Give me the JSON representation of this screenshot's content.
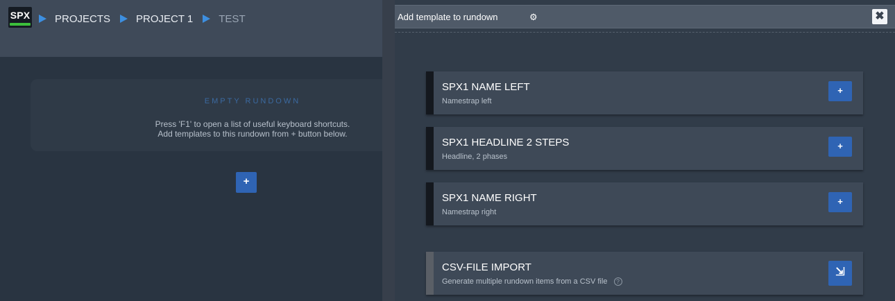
{
  "logo": {
    "text": "SPX",
    "accent": "#3cbf3c"
  },
  "breadcrumb": [
    {
      "label": "PROJECTS"
    },
    {
      "label": "PROJECT 1"
    },
    {
      "label": "TEST"
    }
  ],
  "rundown": {
    "empty_title": "EMPTY RUNDOWN",
    "help_line1": "Press 'F1' to open a list of useful keyboard shortcuts.",
    "help_line2": "Add templates to this rundown from + button below.",
    "add_label": "+"
  },
  "panel": {
    "title": "Add template to rundown",
    "settings_icon": "gear-icon",
    "close_icon": "close-icon",
    "close_label": "✖"
  },
  "templates": [
    {
      "title": "SPX1 NAME LEFT",
      "subtitle": "Namestrap left",
      "button_label": "+"
    },
    {
      "title": "SPX1 HEADLINE 2 STEPS",
      "subtitle": "Headline, 2 phases",
      "button_label": "+"
    },
    {
      "title": "SPX1 NAME RIGHT",
      "subtitle": "Namestrap right",
      "button_label": "+"
    }
  ],
  "csv_import": {
    "title": "CSV-FILE IMPORT",
    "subtitle": "Generate multiple rundown items from a CSV file",
    "help_icon": "help-icon",
    "help_label": "?",
    "button_icon": "file-import-icon",
    "button_label": "⇲"
  },
  "colors": {
    "accent_blue": "#2f64b4",
    "breadcrumb_arrow": "#3d8fe0"
  }
}
